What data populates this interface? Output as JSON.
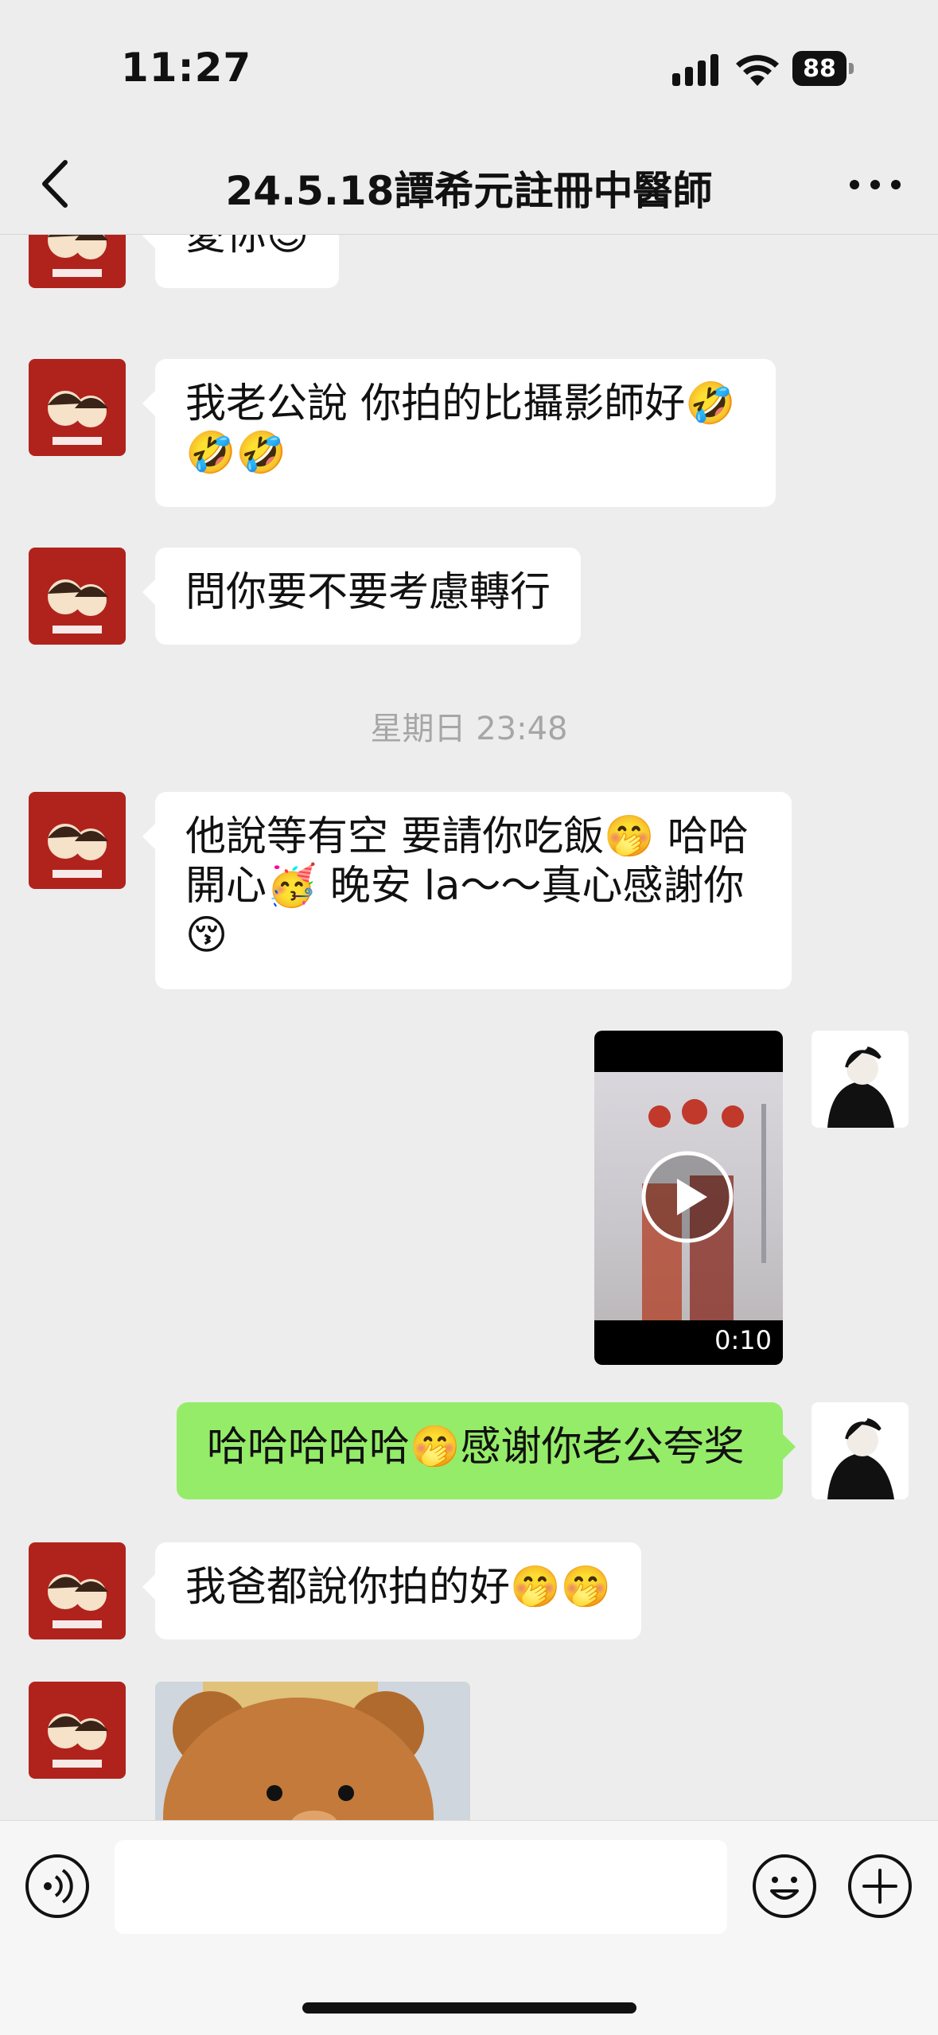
{
  "status_bar": {
    "time": "11:27",
    "battery": "88"
  },
  "nav": {
    "title": "24.5.18譚希元註冊中醫師"
  },
  "messages": [
    {
      "from": "other",
      "text": "愛你😍"
    },
    {
      "from": "other",
      "text": "我老公說 你拍的比攝影師好🤣\n🤣🤣"
    },
    {
      "from": "other",
      "text": "問你要不要考慮轉行"
    },
    {
      "timestamp": "星期日 23:48"
    },
    {
      "from": "other",
      "text": "他說等有空 要請你吃飯🤭 哈哈\n開心🥳 晚安 la～～真心感謝你\n😚"
    },
    {
      "from": "self",
      "type": "video",
      "duration": "0:10"
    },
    {
      "from": "self",
      "text": "哈哈哈哈哈🤭感谢你老公夸奖"
    },
    {
      "from": "other",
      "text": "我爸都說你拍的好🤭🤭"
    },
    {
      "from": "other",
      "type": "image"
    }
  ],
  "icons": {
    "back": "chevron-left-icon",
    "more": "more-dots-icon",
    "voice": "voice-icon",
    "emoji": "emoji-icon",
    "plus": "plus-icon",
    "play": "play-icon"
  },
  "colors": {
    "self_bubble": "#95ec69",
    "other_bubble": "#ffffff",
    "avatar_bg": "#b0231c",
    "background": "#ededed"
  }
}
